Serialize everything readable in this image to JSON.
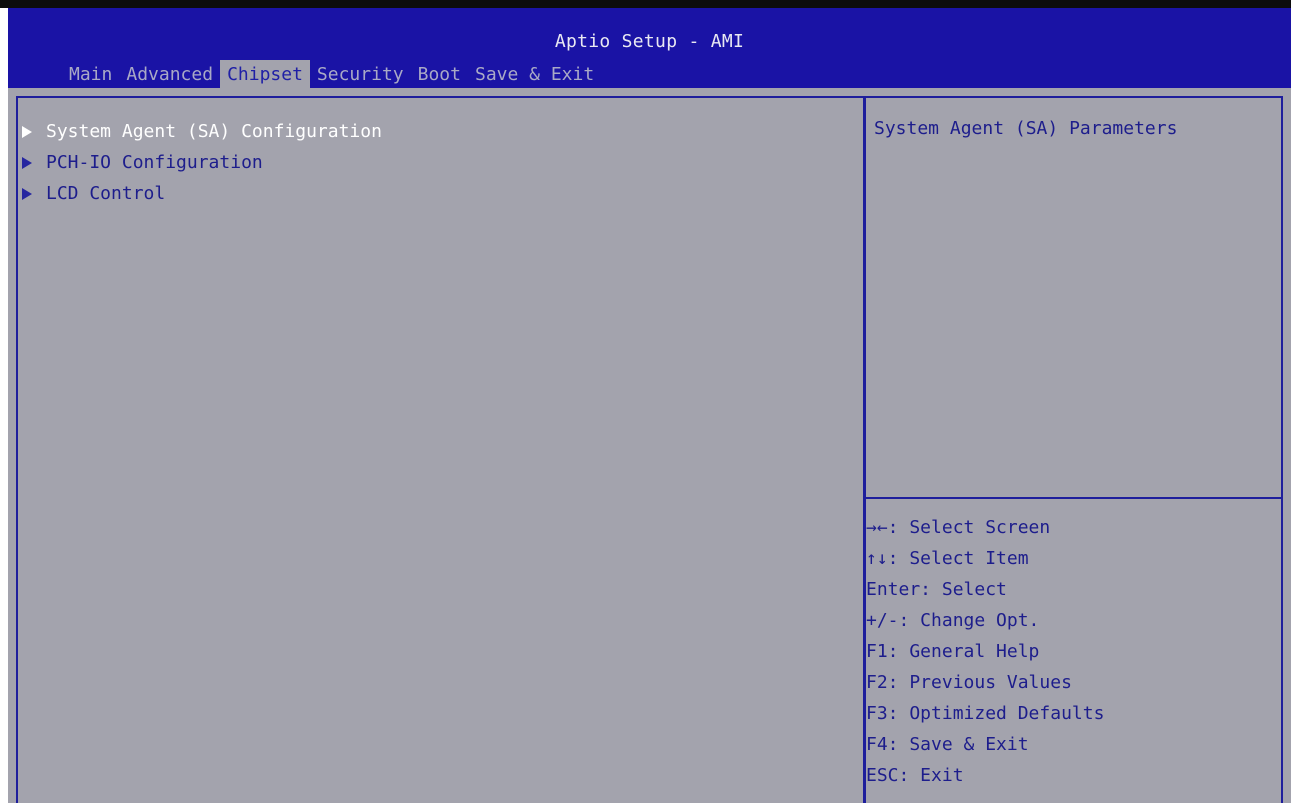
{
  "header": {
    "title": "Aptio Setup - AMI",
    "tabs": [
      {
        "label": "Main",
        "active": false
      },
      {
        "label": "Advanced",
        "active": false
      },
      {
        "label": "Chipset",
        "active": true
      },
      {
        "label": "Security",
        "active": false
      },
      {
        "label": "Boot",
        "active": false
      },
      {
        "label": "Save & Exit",
        "active": false
      }
    ]
  },
  "menu": {
    "items": [
      {
        "label": "System Agent (SA) Configuration",
        "selected": true
      },
      {
        "label": "PCH-IO Configuration",
        "selected": false
      },
      {
        "label": "LCD Control",
        "selected": false
      }
    ]
  },
  "help": {
    "text": "System Agent (SA) Parameters"
  },
  "keys": {
    "lines": [
      "→←: Select Screen",
      "↑↓: Select Item",
      "Enter: Select",
      "+/-: Change Opt.",
      "F1: General Help",
      "F2: Previous Values",
      "F3: Optimized Defaults",
      "F4: Save & Exit",
      "ESC: Exit"
    ]
  },
  "colors": {
    "header_bg": "#1a13a5",
    "content_bg": "#a3a3ad",
    "border": "#1e1e9c",
    "text": "#1d1d8c",
    "selected_text": "#ffffff"
  }
}
